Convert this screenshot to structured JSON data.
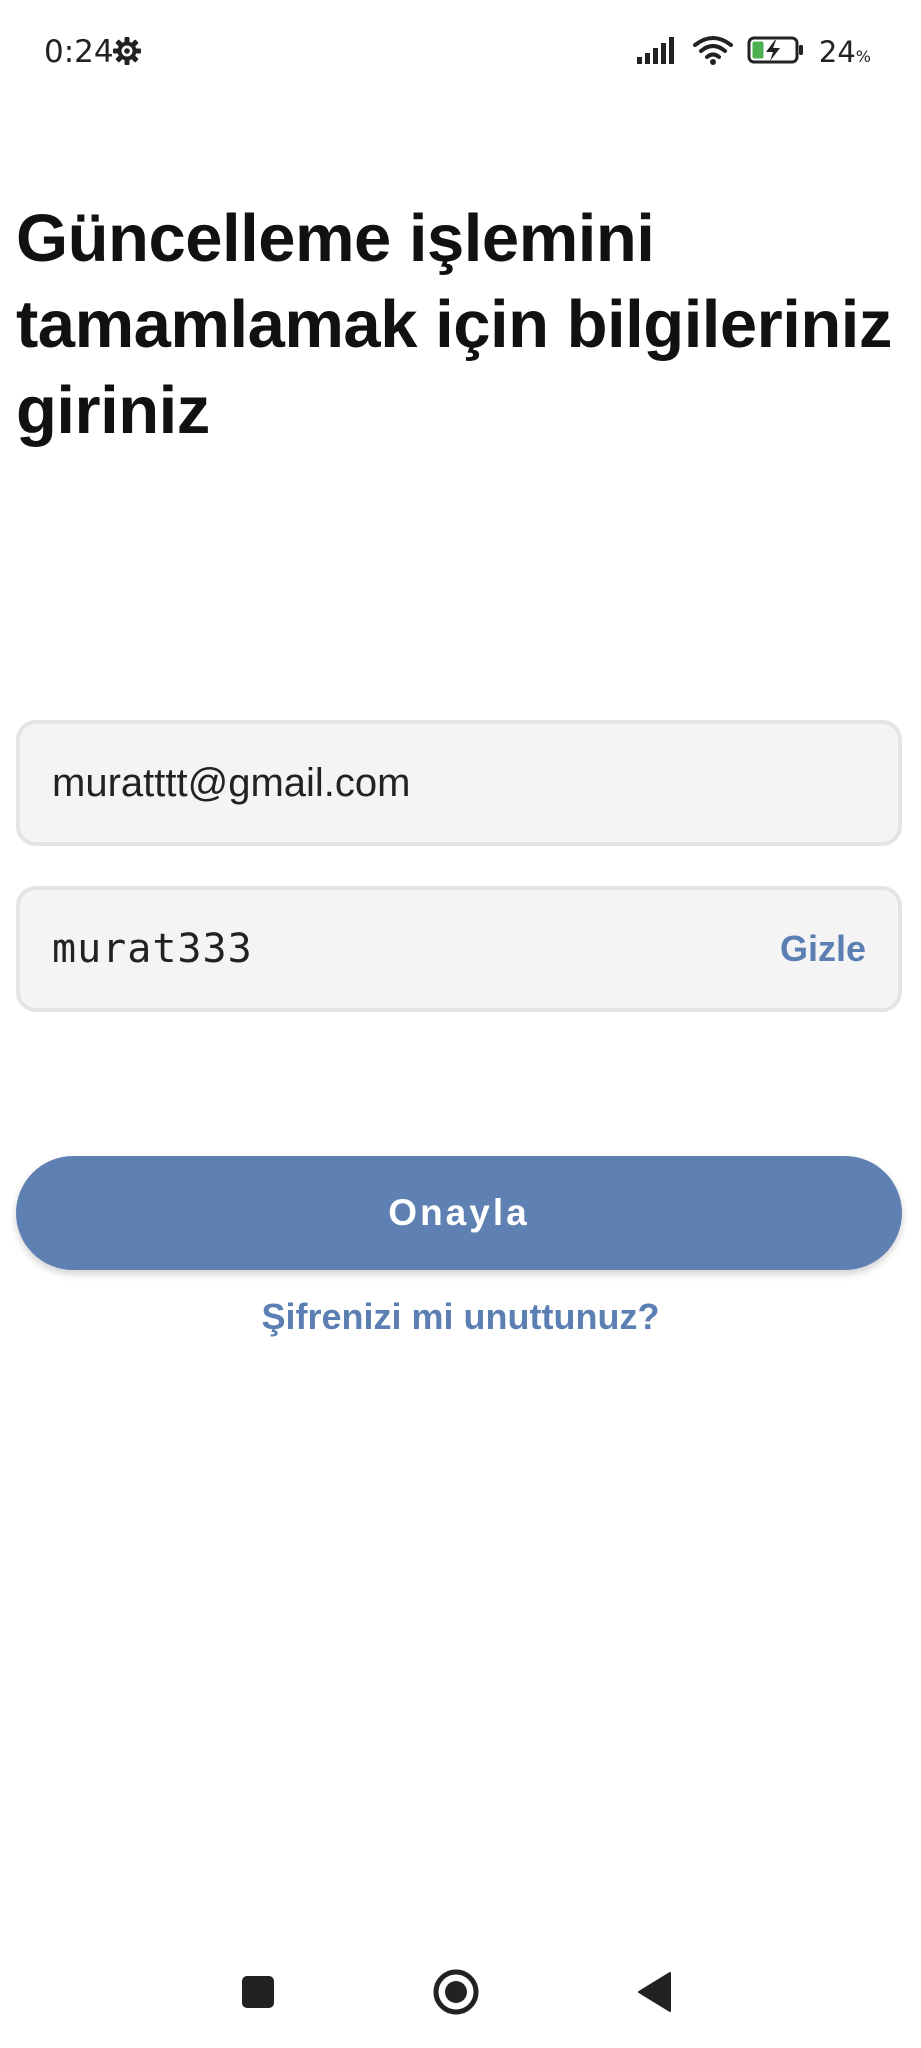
{
  "status_bar": {
    "time": "0:24",
    "battery_percent": "24",
    "battery_percent_sign": "%",
    "icons": [
      "gear-icon",
      "signal-icon",
      "wifi-icon",
      "battery-charging-icon"
    ]
  },
  "heading": "Güncelleme işlemini tamamlamak için bilgileriniz giriniz",
  "form": {
    "email_value": "muratttt@gmail.com",
    "password_value": "murat333",
    "hide_label": "Gizle",
    "confirm_label": "Onayla",
    "forgot_label": "Şifrenizi mi unuttunuz?"
  },
  "nav_bar": {
    "icons": [
      "recent-apps-icon",
      "home-icon",
      "back-icon"
    ]
  },
  "colors": {
    "accent": "#5f80b3",
    "link": "#5b7fb2",
    "field_bg": "#f4f4f4",
    "field_border": "#e4e4e4"
  }
}
